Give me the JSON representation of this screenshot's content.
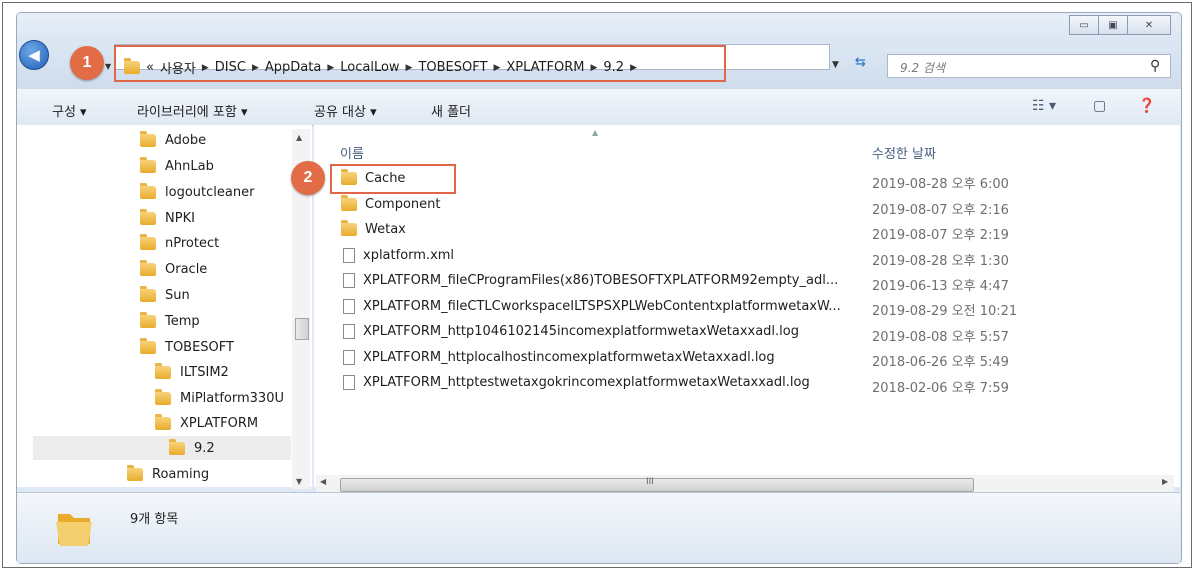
{
  "window": {
    "minimize_glyph": "▭",
    "maximize_glyph": "▣",
    "close_glyph": "✕"
  },
  "badges": {
    "one": "1",
    "two": "2"
  },
  "address": {
    "overflow": "«",
    "crumbs": [
      "사용자",
      "DISC",
      "AppData",
      "LocalLow",
      "TOBESOFT",
      "XPLATFORM",
      "9.2"
    ],
    "sep": "▶"
  },
  "search": {
    "placeholder": "9.2 검색"
  },
  "toolbar": {
    "organize": "구성 ▾",
    "include_library": "라이브러리에 포함 ▾",
    "share": "공유 대상 ▾",
    "new_folder": "새 폴더"
  },
  "tree": [
    {
      "label": "Adobe"
    },
    {
      "label": "AhnLab"
    },
    {
      "label": "logoutcleaner"
    },
    {
      "label": "NPKI"
    },
    {
      "label": "nProtect"
    },
    {
      "label": "Oracle"
    },
    {
      "label": "Sun"
    },
    {
      "label": "Temp"
    },
    {
      "label": "TOBESOFT"
    },
    {
      "label": "ILTSIM2"
    },
    {
      "label": "MiPlatform330U"
    },
    {
      "label": "XPLATFORM"
    },
    {
      "label": "9.2"
    },
    {
      "label": "Roaming"
    }
  ],
  "columns": {
    "name": "이름",
    "date": "수정한 날짜"
  },
  "files": [
    {
      "name": "Cache",
      "date": "2019-08-28 오후 6:00",
      "type": "folder"
    },
    {
      "name": "Component",
      "date": "2019-08-07 오후 2:16",
      "type": "folder"
    },
    {
      "name": "Wetax",
      "date": "2019-08-07 오후 2:19",
      "type": "folder"
    },
    {
      "name": "xplatform.xml",
      "date": "2019-08-28 오후 1:30",
      "type": "file"
    },
    {
      "name": "XPLATFORM_fileCProgramFiles(x86)TOBESOFTXPLATFORM92empty_adl...",
      "date": "2019-06-13 오후 4:47",
      "type": "file"
    },
    {
      "name": "XPLATFORM_fileCTLCworkspaceILTSPSXPLWebContentxplatformwetaxW...",
      "date": "2019-08-29 오전 10:21",
      "type": "file"
    },
    {
      "name": "XPLATFORM_http1046102145incomexplatformwetaxWetaxxadl.log",
      "date": "2019-08-08 오후 5:57",
      "type": "file"
    },
    {
      "name": "XPLATFORM_httplocalhostincomexplatformwetaxWetaxxadl.log",
      "date": "2018-06-26 오후 5:49",
      "type": "file"
    },
    {
      "name": "XPLATFORM_httptestwetaxgokrincomexplatformwetaxWetaxxadl.log",
      "date": "2018-02-06 오후 7:59",
      "type": "file"
    }
  ],
  "hscroll_grip": "III",
  "status": {
    "count": "9개 항목"
  },
  "colors": {
    "highlight": "#e0664a",
    "folder": "#e8ab2c"
  }
}
